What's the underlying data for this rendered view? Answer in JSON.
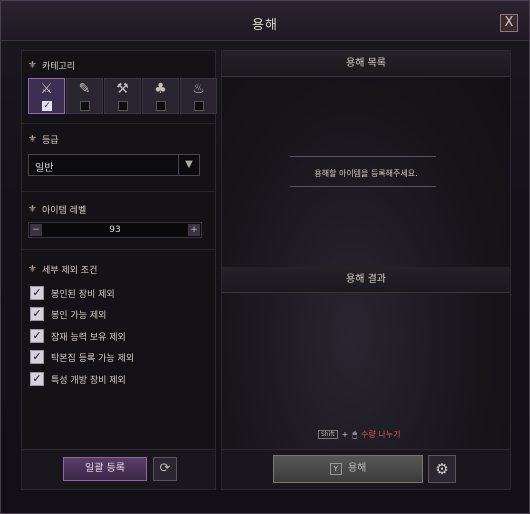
{
  "window": {
    "title": "용해",
    "close_label": "X"
  },
  "left": {
    "category_title": "카테고리",
    "categories": [
      {
        "icon": "weapon-icon",
        "glyph": "⚔",
        "checked": true
      },
      {
        "icon": "feather-icon",
        "glyph": "✎",
        "checked": false
      },
      {
        "icon": "anvil-icon",
        "glyph": "⚒",
        "checked": false
      },
      {
        "icon": "pouch-icon",
        "glyph": "♣",
        "checked": false
      },
      {
        "icon": "flame-icon",
        "glyph": "♨",
        "checked": false
      }
    ],
    "grade_title": "등급",
    "grade_value": "일반",
    "level_title": "아이템 레벨",
    "level_value": "93",
    "filter_title": "세부 제외 조건",
    "options": [
      {
        "label": "봉인된 장비 제외",
        "checked": true
      },
      {
        "label": "봉인 가능 제외",
        "checked": true
      },
      {
        "label": "잠재 능력 보유 제외",
        "checked": true
      },
      {
        "label": "탁본집 등록 가능 제외",
        "checked": true
      },
      {
        "label": "특성 개방 장비 제외",
        "checked": true
      }
    ],
    "register_all": "일괄 등록"
  },
  "right": {
    "list_title": "용해 목록",
    "hint": "용해할 아이템을 등록해주세요.",
    "result_title": "용해 결과",
    "shift_key": "Shift",
    "plus": "+",
    "split_label": "수량 나누기",
    "key_y": "Y",
    "fuse_label": "용해"
  },
  "colors": {
    "accent": "#8a6fb0",
    "warning": "#d95a5a"
  }
}
